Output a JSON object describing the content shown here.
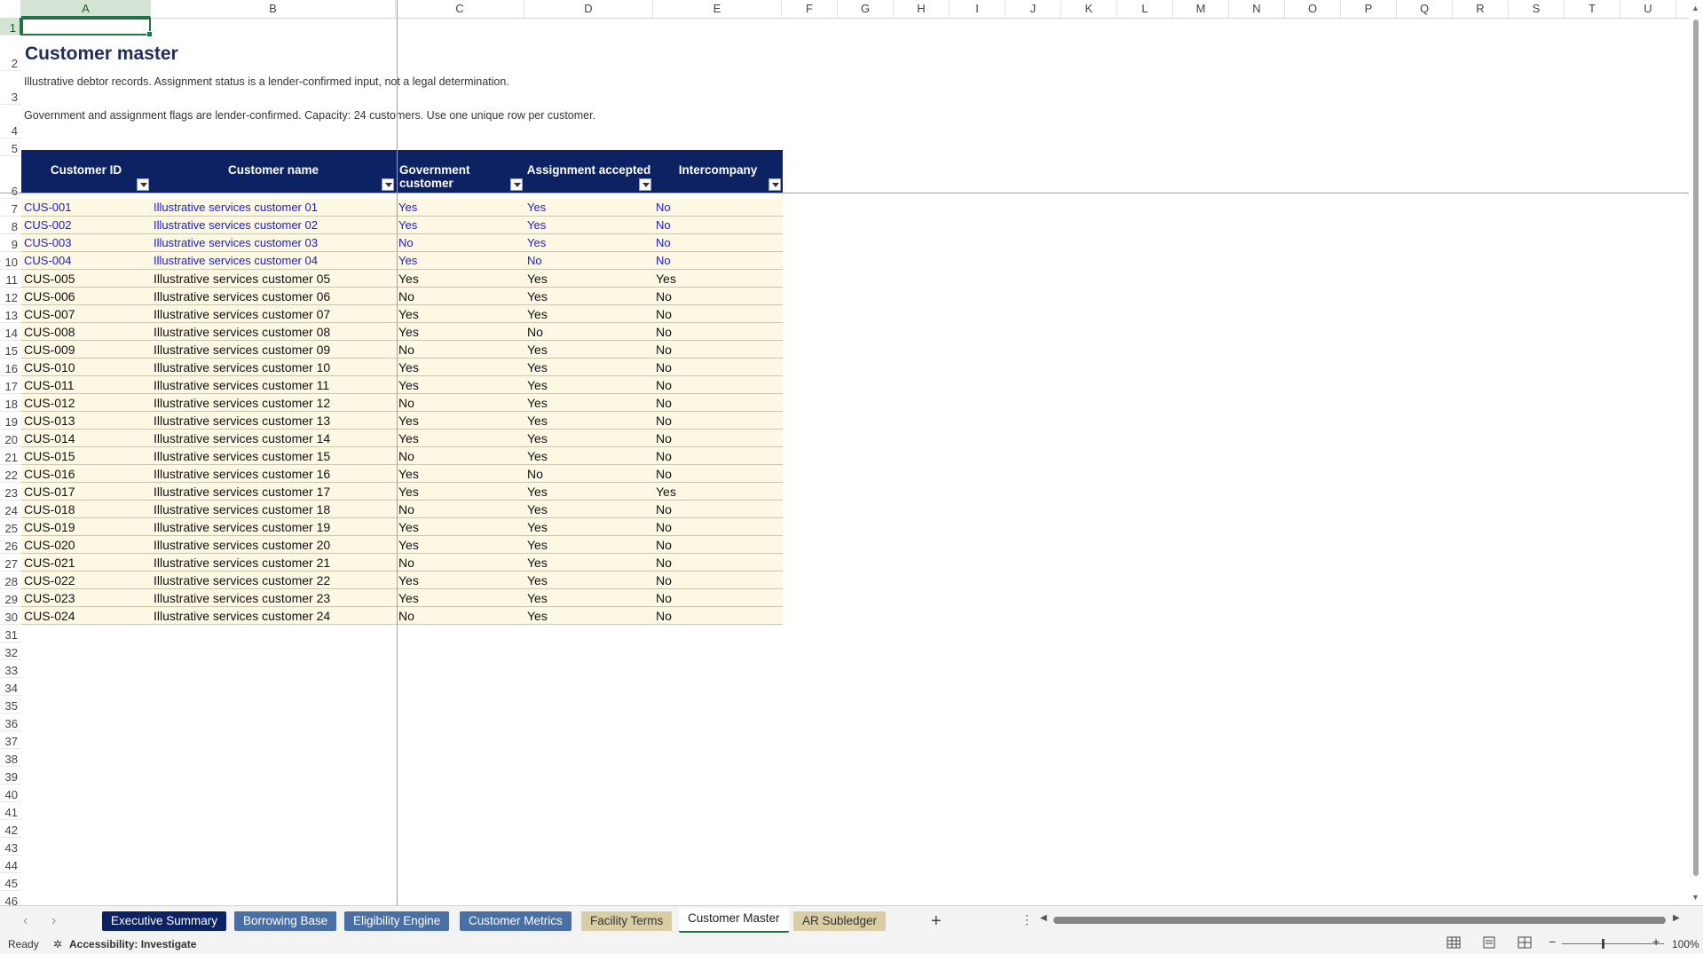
{
  "sheet": {
    "title": "Customer master",
    "note1": "Illustrative debtor records. Assignment status is a lender-confirmed input, not a legal determination.",
    "note2": "Government and assignment flags are lender-confirmed. Capacity: 24 customers. Use one unique row per customer."
  },
  "columns": [
    "A",
    "B",
    "C",
    "D",
    "E",
    "F",
    "G",
    "H",
    "I",
    "J",
    "K",
    "L",
    "M",
    "N",
    "O",
    "P",
    "Q",
    "R",
    "S",
    "T",
    "U"
  ],
  "rows": [
    "1",
    "2",
    "3",
    "4",
    "5",
    "6",
    "7",
    "8",
    "9",
    "10",
    "11",
    "12",
    "13",
    "14",
    "15",
    "16",
    "17",
    "18",
    "19",
    "20",
    "21",
    "22",
    "23",
    "24",
    "25",
    "26",
    "27",
    "28",
    "29",
    "30",
    "31",
    "32",
    "33",
    "34",
    "35",
    "36",
    "37",
    "38",
    "39",
    "40",
    "41",
    "42",
    "43",
    "44",
    "45",
    "46"
  ],
  "table": {
    "headers": [
      "Customer ID",
      "Customer name",
      "Government customer",
      "Assignment accepted",
      "Intercompany"
    ],
    "records": [
      [
        "CUS-001",
        "Illustrative services customer 01",
        "Yes",
        "Yes",
        "No"
      ],
      [
        "CUS-002",
        "Illustrative services customer 02",
        "Yes",
        "Yes",
        "No"
      ],
      [
        "CUS-003",
        "Illustrative services customer 03",
        "No",
        "Yes",
        "No"
      ],
      [
        "CUS-004",
        "Illustrative services customer 04",
        "Yes",
        "No",
        "No"
      ],
      [
        "CUS-005",
        "Illustrative services customer 05",
        "Yes",
        "Yes",
        "Yes"
      ],
      [
        "CUS-006",
        "Illustrative services customer 06",
        "No",
        "Yes",
        "No"
      ],
      [
        "CUS-007",
        "Illustrative services customer 07",
        "Yes",
        "Yes",
        "No"
      ],
      [
        "CUS-008",
        "Illustrative services customer 08",
        "Yes",
        "No",
        "No"
      ],
      [
        "CUS-009",
        "Illustrative services customer 09",
        "No",
        "Yes",
        "No"
      ],
      [
        "CUS-010",
        "Illustrative services customer 10",
        "Yes",
        "Yes",
        "No"
      ],
      [
        "CUS-011",
        "Illustrative services customer 11",
        "Yes",
        "Yes",
        "No"
      ],
      [
        "CUS-012",
        "Illustrative services customer 12",
        "No",
        "Yes",
        "No"
      ],
      [
        "CUS-013",
        "Illustrative services customer 13",
        "Yes",
        "Yes",
        "No"
      ],
      [
        "CUS-014",
        "Illustrative services customer 14",
        "Yes",
        "Yes",
        "No"
      ],
      [
        "CUS-015",
        "Illustrative services customer 15",
        "No",
        "Yes",
        "No"
      ],
      [
        "CUS-016",
        "Illustrative services customer 16",
        "Yes",
        "No",
        "No"
      ],
      [
        "CUS-017",
        "Illustrative services customer 17",
        "Yes",
        "Yes",
        "Yes"
      ],
      [
        "CUS-018",
        "Illustrative services customer 18",
        "No",
        "Yes",
        "No"
      ],
      [
        "CUS-019",
        "Illustrative services customer 19",
        "Yes",
        "Yes",
        "No"
      ],
      [
        "CUS-020",
        "Illustrative services customer 20",
        "Yes",
        "Yes",
        "No"
      ],
      [
        "CUS-021",
        "Illustrative services customer 21",
        "No",
        "Yes",
        "No"
      ],
      [
        "CUS-022",
        "Illustrative services customer 22",
        "Yes",
        "Yes",
        "No"
      ],
      [
        "CUS-023",
        "Illustrative services customer 23",
        "Yes",
        "Yes",
        "No"
      ],
      [
        "CUS-024",
        "Illustrative services customer 24",
        "No",
        "Yes",
        "No"
      ]
    ],
    "input_rows": 4
  },
  "tabs": [
    {
      "label": "Executive Summary",
      "bg": "#0c2263",
      "fg": "#ffffff"
    },
    {
      "label": "Borrowing Base",
      "bg": "#4a6fa5",
      "fg": "#ffffff"
    },
    {
      "label": "Eligibility Engine",
      "bg": "#4a6fa5",
      "fg": "#ffffff"
    },
    {
      "label": "Customer Metrics",
      "bg": "#4a6fa5",
      "fg": "#ffffff"
    },
    {
      "label": "Facility Terms",
      "bg": "#d9cda4",
      "fg": "#333333"
    },
    {
      "label": "Customer Master",
      "bg": "#ffffff",
      "fg": "#222222",
      "active": true
    },
    {
      "label": "AR Subledger",
      "bg": "#d9cda4",
      "fg": "#333333"
    }
  ],
  "status": {
    "ready": "Ready",
    "accessibility": "Accessibility: Investigate",
    "zoom": "100%"
  },
  "colors": {
    "header_bg": "#0c2263",
    "row_bg": "#fdf8e4",
    "input_text": "#1a1ad6",
    "select_green": "#217346"
  }
}
